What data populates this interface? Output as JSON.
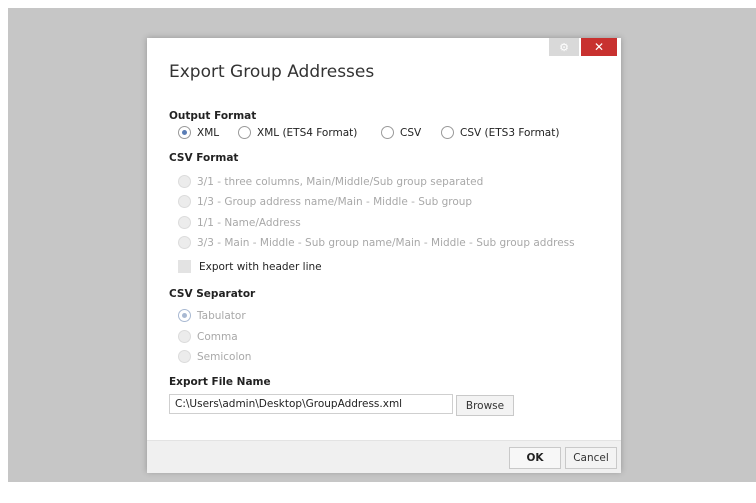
{
  "dialog": {
    "title": "Export Group Addresses",
    "settings_icon": "gear-icon",
    "close_icon": "close-icon",
    "close_glyph": "✕",
    "settings_glyph": "⚙"
  },
  "output_format": {
    "label": "Output Format",
    "options": [
      "XML",
      "XML (ETS4 Format)",
      "CSV",
      "CSV (ETS3 Format)"
    ],
    "selected": "XML"
  },
  "csv_format": {
    "label": "CSV Format",
    "options": [
      "3/1 - three columns, Main/Middle/Sub group separated",
      "1/3 - Group address name/Main - Middle - Sub group",
      "1/1 - Name/Address",
      "3/3 - Main - Middle - Sub group name/Main - Middle - Sub group address"
    ],
    "header_line_label": "Export with header line"
  },
  "csv_separator": {
    "label": "CSV Separator",
    "options": [
      "Tabulator",
      "Comma",
      "Semicolon"
    ],
    "selected": "Tabulator"
  },
  "export_file": {
    "label": "Export File Name",
    "value": "C:\\Users\\admin\\Desktop\\GroupAddress.xml",
    "browse_label": "Browse"
  },
  "footer": {
    "ok_label": "OK",
    "cancel_label": "Cancel"
  },
  "colors": {
    "close_button": "#c8312f",
    "radio_accent": "#5a7db5",
    "overlay": "#c6c6c6"
  }
}
